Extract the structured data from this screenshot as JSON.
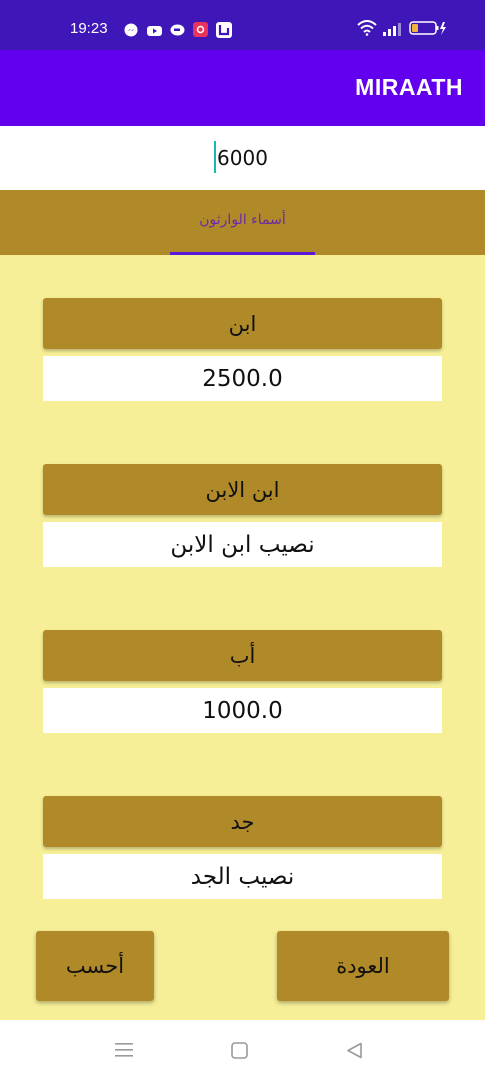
{
  "status_bar": {
    "time": "19:23",
    "notification_icons": [
      "messenger-icon",
      "youtube-icon",
      "chat-icon",
      "screen-recorder-icon",
      "app-icon"
    ],
    "system_icons": [
      "wifi-icon",
      "signal-icon",
      "battery-icon"
    ]
  },
  "app_bar": {
    "title": "MIRAATH"
  },
  "amount_input": {
    "value": "6000"
  },
  "tabs": [
    {
      "label": "أسماء الوارثون",
      "selected": true
    }
  ],
  "heirs": [
    {
      "name": "ابن",
      "share": "2500.0"
    },
    {
      "name": "ابن الابن",
      "share": "نصيب ابن الابن"
    },
    {
      "name": "أب",
      "share": "1000.0"
    },
    {
      "name": "جد",
      "share": "نصيب الجد"
    }
  ],
  "actions": {
    "calculate_label": "أحسب",
    "back_label": "العودة"
  },
  "nav_bar": {
    "icons": [
      "recents-icon",
      "home-icon",
      "back-icon"
    ]
  },
  "colors": {
    "status_bar": "#3f17b8",
    "app_bar": "#6200ee",
    "tab_bar": "#b08a28",
    "content_bg": "#f7ef97",
    "button": "#b08a28",
    "tab_indicator": "#5b17d6",
    "cursor": "#17b8b0"
  }
}
